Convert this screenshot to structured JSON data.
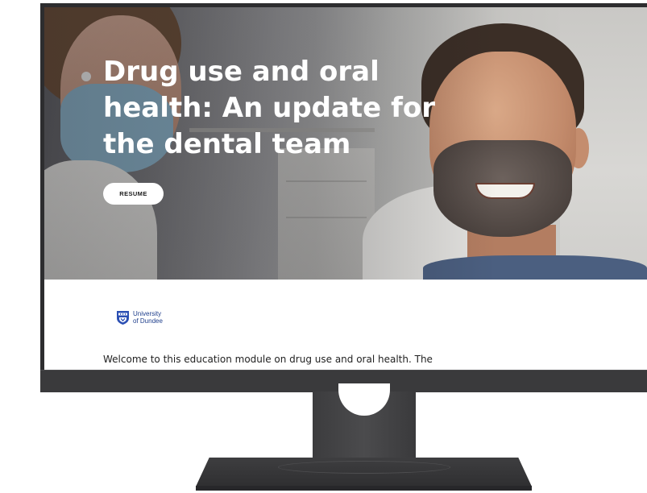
{
  "hero": {
    "title": "Drug use and oral health: An update for the dental team",
    "resume_label": "RESUME"
  },
  "logo": {
    "line1": "University",
    "line2": "of Dundee",
    "crest_icon": "university-crest-icon"
  },
  "content": {
    "intro": "Welcome to this education module on drug use and oral health. The"
  },
  "colors": {
    "monitor_bezel": "#2d2d2f",
    "logo_blue": "#1f3f8c",
    "page_background": "#ffffff"
  }
}
